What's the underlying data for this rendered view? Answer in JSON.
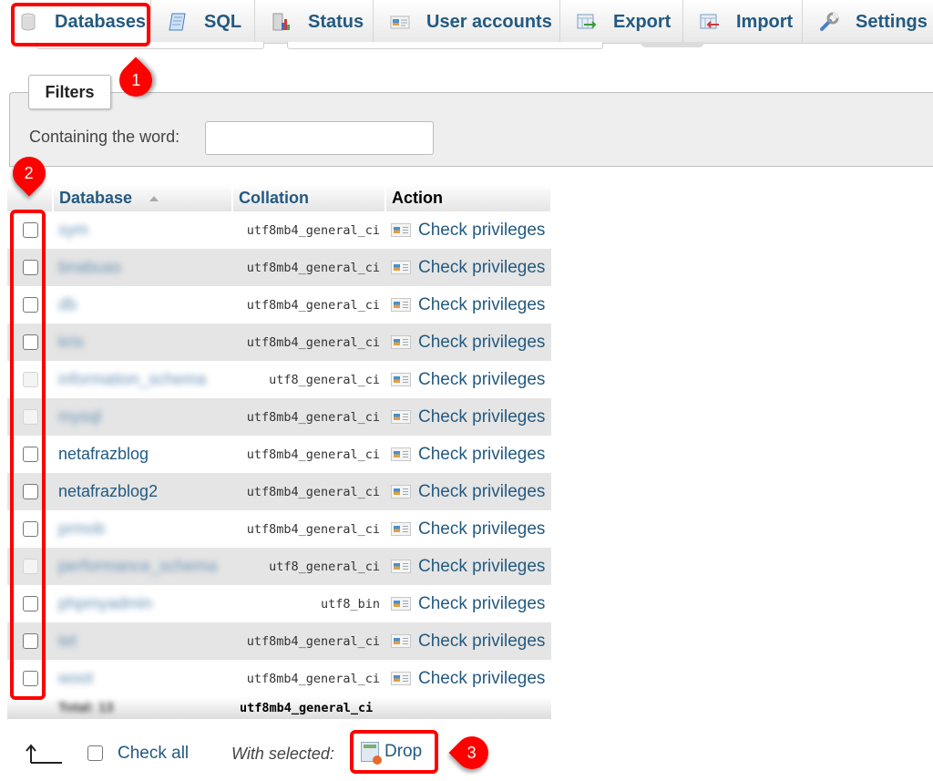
{
  "tabs": [
    {
      "label": "Databases",
      "icon": "database-icon",
      "active": true
    },
    {
      "label": "SQL",
      "icon": "sql-scroll-icon",
      "active": false
    },
    {
      "label": "Status",
      "icon": "status-chart-icon",
      "active": false
    },
    {
      "label": "User accounts",
      "icon": "user-card-icon",
      "active": false
    },
    {
      "label": "Export",
      "icon": "export-icon",
      "active": false
    },
    {
      "label": "Import",
      "icon": "import-icon",
      "active": false
    },
    {
      "label": "Settings",
      "icon": "wrench-icon",
      "active": false
    }
  ],
  "filters": {
    "legend": "Filters",
    "label": "Containing the word:",
    "value": ""
  },
  "table": {
    "headers": {
      "database": "Database",
      "collation": "Collation",
      "action": "Action"
    },
    "action_label": "Check privileges",
    "rows": [
      {
        "name": "sym",
        "blurred": true,
        "collation": "utf8mb4_general_ci",
        "checkable": true
      },
      {
        "name": "bnabuas",
        "blurred": true,
        "collation": "utf8mb4_general_ci",
        "checkable": true
      },
      {
        "name": "db",
        "blurred": true,
        "collation": "utf8mb4_general_ci",
        "checkable": true
      },
      {
        "name": "kris",
        "blurred": true,
        "collation": "utf8mb4_general_ci",
        "checkable": true
      },
      {
        "name": "information_schema",
        "blurred": true,
        "collation": "utf8_general_ci",
        "checkable": false
      },
      {
        "name": "mysql",
        "blurred": true,
        "collation": "utf8mb4_general_ci",
        "checkable": false
      },
      {
        "name": "netafrazblog",
        "blurred": false,
        "collation": "utf8mb4_general_ci",
        "checkable": true
      },
      {
        "name": "netafrazblog2",
        "blurred": false,
        "collation": "utf8mb4_general_ci",
        "checkable": true
      },
      {
        "name": "prmob",
        "blurred": true,
        "collation": "utf8mb4_general_ci",
        "checkable": true
      },
      {
        "name": "performance_schema",
        "blurred": true,
        "collation": "utf8_general_ci",
        "checkable": false
      },
      {
        "name": "phpmyadmin",
        "blurred": true,
        "collation": "utf8_bin",
        "checkable": true
      },
      {
        "name": "tet",
        "blurred": true,
        "collation": "utf8mb4_general_ci",
        "checkable": true
      },
      {
        "name": "woot",
        "blurred": true,
        "collation": "utf8mb4_general_ci",
        "checkable": true
      }
    ],
    "totals": {
      "label": "Total: 13",
      "collation": "utf8mb4_general_ci"
    }
  },
  "footer": {
    "check_all": "Check all",
    "with_selected": "With selected:",
    "drop": "Drop"
  },
  "annotations": {
    "markers": [
      "1",
      "2",
      "3"
    ],
    "highlight_color": "#ff0000"
  },
  "colors": {
    "link": "#235a81",
    "row_alt": "#e5e5e5",
    "filters_bg": "#eeeeee"
  }
}
